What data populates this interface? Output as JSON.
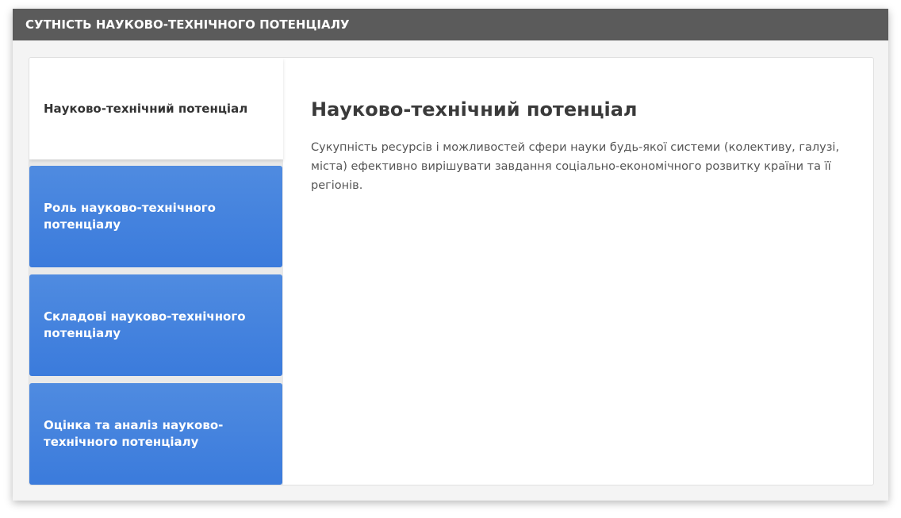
{
  "header": {
    "title": "СУТНІСТЬ НАУКОВО-ТЕХНІЧНОГО ПОТЕНЦІАЛУ"
  },
  "tabs": [
    {
      "label": "Науково-технічний потенціал",
      "active": true
    },
    {
      "label": "Роль науково-технічного потенціалу",
      "active": false
    },
    {
      "label": "Складові науково-технічного потенціалу",
      "active": false
    },
    {
      "label": "Оцінка та аналіз науково-технічного потенціалу",
      "active": false
    }
  ],
  "content": {
    "heading": "Науково-технічний потенціал",
    "body": "Сукупність ресурсів і можливостей сфери науки будь-якої системи (колективу, галузі, міста) ефективно вирішувати завдання соціально-економічного розвитку країни та її регіонів."
  },
  "colors": {
    "header_bg": "#5b5b5b",
    "tab_blue": "#3b7bdc",
    "active_tab_bg": "#ffffff"
  }
}
